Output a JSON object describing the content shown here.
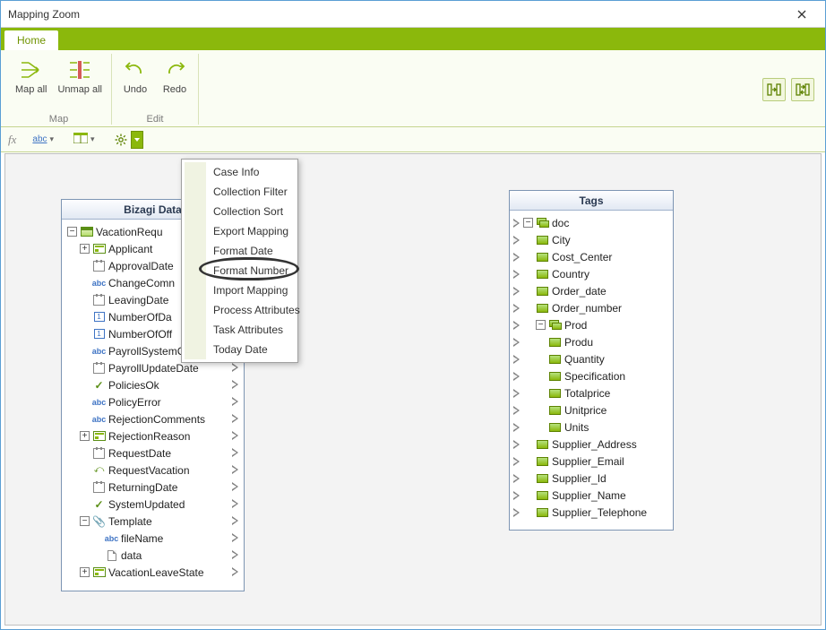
{
  "window": {
    "title": "Mapping Zoom"
  },
  "tabs": {
    "home": "Home"
  },
  "ribbon": {
    "map": {
      "mapall": "Map all",
      "unmapall": "Unmap all",
      "group": "Map"
    },
    "edit": {
      "undo": "Undo",
      "redo": "Redo",
      "group": "Edit"
    }
  },
  "fxbar": {
    "fx": "fx"
  },
  "context_menu": {
    "items": [
      "Case Info",
      "Collection Filter",
      "Collection Sort",
      "Export Mapping",
      "Format Date",
      "Format Number",
      "Import Mapping",
      "Process Attributes",
      "Task Attributes",
      "Today Date"
    ],
    "highlighted_index": 5
  },
  "left_panel": {
    "title": "Bizagi Data",
    "nodes": [
      {
        "indent": 0,
        "expander": "-",
        "icon": "entity",
        "label": "VacationRequ"
      },
      {
        "indent": 1,
        "expander": "+",
        "icon": "collection",
        "label": "Applicant"
      },
      {
        "indent": 1,
        "expander": "",
        "icon": "date",
        "label": "ApprovalDate"
      },
      {
        "indent": 1,
        "expander": "",
        "icon": "text",
        "label": "ChangeComn"
      },
      {
        "indent": 1,
        "expander": "",
        "icon": "date",
        "label": "LeavingDate"
      },
      {
        "indent": 1,
        "expander": "",
        "icon": "num",
        "label": "NumberOfDa"
      },
      {
        "indent": 1,
        "expander": "",
        "icon": "num",
        "label": "NumberOfOff"
      },
      {
        "indent": 1,
        "expander": "",
        "icon": "text",
        "label": "PayrollSystemCode"
      },
      {
        "indent": 1,
        "expander": "",
        "icon": "date",
        "label": "PayrollUpdateDate"
      },
      {
        "indent": 1,
        "expander": "",
        "icon": "check",
        "label": "PoliciesOk"
      },
      {
        "indent": 1,
        "expander": "",
        "icon": "text",
        "label": "PolicyError"
      },
      {
        "indent": 1,
        "expander": "",
        "icon": "text",
        "label": "RejectionComments"
      },
      {
        "indent": 1,
        "expander": "+",
        "icon": "collection",
        "label": "RejectionReason"
      },
      {
        "indent": 1,
        "expander": "",
        "icon": "date",
        "label": "RequestDate"
      },
      {
        "indent": 1,
        "expander": "",
        "icon": "bool",
        "label": "RequestVacation"
      },
      {
        "indent": 1,
        "expander": "",
        "icon": "date",
        "label": "ReturningDate"
      },
      {
        "indent": 1,
        "expander": "",
        "icon": "check",
        "label": "SystemUpdated"
      },
      {
        "indent": 1,
        "expander": "-",
        "icon": "attach",
        "label": "Template"
      },
      {
        "indent": 2,
        "expander": "",
        "icon": "text",
        "label": "fileName"
      },
      {
        "indent": 2,
        "expander": "",
        "icon": "file",
        "label": "data"
      },
      {
        "indent": 1,
        "expander": "+",
        "icon": "collection",
        "label": "VacationLeaveState"
      }
    ]
  },
  "right_panel": {
    "title": "Tags",
    "nodes": [
      {
        "indent": 0,
        "expander": "-",
        "icon": "tag2",
        "label": "doc"
      },
      {
        "indent": 1,
        "expander": "",
        "icon": "tag",
        "label": "City"
      },
      {
        "indent": 1,
        "expander": "",
        "icon": "tag",
        "label": "Cost_Center"
      },
      {
        "indent": 1,
        "expander": "",
        "icon": "tag",
        "label": "Country"
      },
      {
        "indent": 1,
        "expander": "",
        "icon": "tag",
        "label": "Order_date"
      },
      {
        "indent": 1,
        "expander": "",
        "icon": "tag",
        "label": "Order_number"
      },
      {
        "indent": 1,
        "expander": "-",
        "icon": "tag2",
        "label": "Prod"
      },
      {
        "indent": 2,
        "expander": "",
        "icon": "tag",
        "label": "Produ"
      },
      {
        "indent": 2,
        "expander": "",
        "icon": "tag",
        "label": "Quantity"
      },
      {
        "indent": 2,
        "expander": "",
        "icon": "tag",
        "label": "Specification"
      },
      {
        "indent": 2,
        "expander": "",
        "icon": "tag",
        "label": "Totalprice"
      },
      {
        "indent": 2,
        "expander": "",
        "icon": "tag",
        "label": "Unitprice"
      },
      {
        "indent": 2,
        "expander": "",
        "icon": "tag",
        "label": "Units"
      },
      {
        "indent": 1,
        "expander": "",
        "icon": "tag",
        "label": "Supplier_Address"
      },
      {
        "indent": 1,
        "expander": "",
        "icon": "tag",
        "label": "Supplier_Email"
      },
      {
        "indent": 1,
        "expander": "",
        "icon": "tag",
        "label": "Supplier_Id"
      },
      {
        "indent": 1,
        "expander": "",
        "icon": "tag",
        "label": "Supplier_Name"
      },
      {
        "indent": 1,
        "expander": "",
        "icon": "tag",
        "label": "Supplier_Telephone"
      }
    ]
  }
}
